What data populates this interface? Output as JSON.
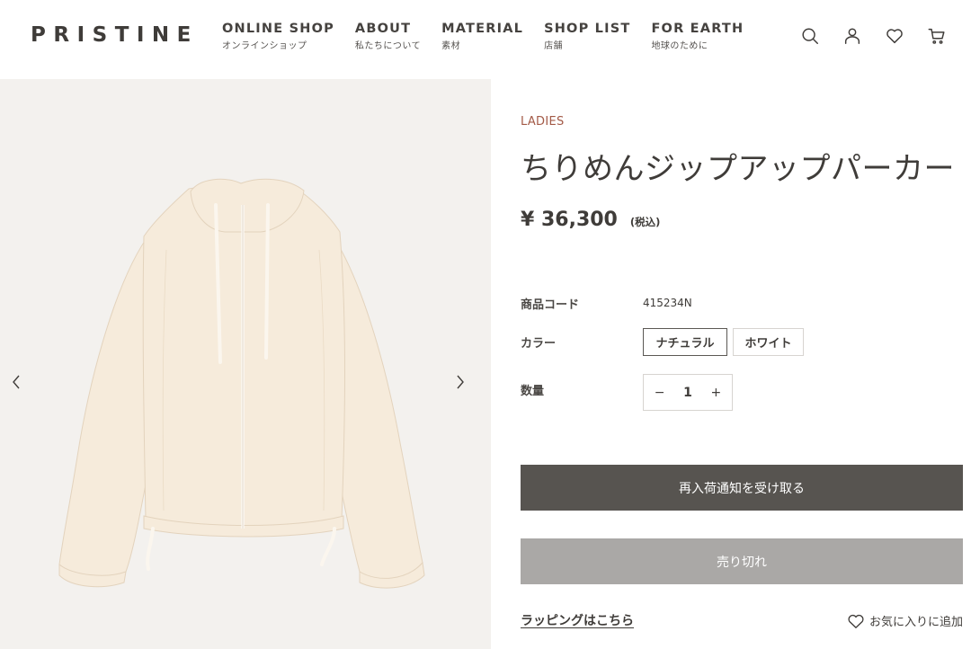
{
  "brand": {
    "logo": "PRISTINE"
  },
  "nav": [
    {
      "en": "ONLINE SHOP",
      "ja": "オンラインショップ"
    },
    {
      "en": "ABOUT",
      "ja": "私たちについて"
    },
    {
      "en": "MATERIAL",
      "ja": "素材"
    },
    {
      "en": "SHOP LIST",
      "ja": "店舗"
    },
    {
      "en": "FOR EARTH",
      "ja": "地球のために"
    }
  ],
  "header_icons": [
    "search-icon",
    "account-icon",
    "heart-icon",
    "cart-icon"
  ],
  "gallery": {
    "prev_icon": "chevron-left-icon",
    "next_icon": "chevron-right-icon",
    "background": "#f3f1ee",
    "garment_color": "#f6ebdb"
  },
  "product": {
    "category": "LADIES",
    "title": "ちりめんジップアップパーカー",
    "price": "¥ 36,300",
    "tax_label": "(税込)",
    "code_label": "商品コード",
    "code": "415234N",
    "color_label": "カラー",
    "colors": [
      {
        "label": "ナチュラル",
        "selected": true
      },
      {
        "label": "ホワイト",
        "selected": false
      }
    ],
    "quantity_label": "数量",
    "quantity": "1",
    "minus": "−",
    "plus": "+"
  },
  "actions": {
    "notify": "再入荷通知を受け取る",
    "soldout": "売り切れ",
    "wrapping": "ラッピングはこちら",
    "favorite": "お気に入りに追加"
  },
  "colors": {
    "accent": "#a35a47",
    "notify_button": "#575450",
    "soldout_button": "#aaa8a6",
    "text": "#3f3c39"
  }
}
